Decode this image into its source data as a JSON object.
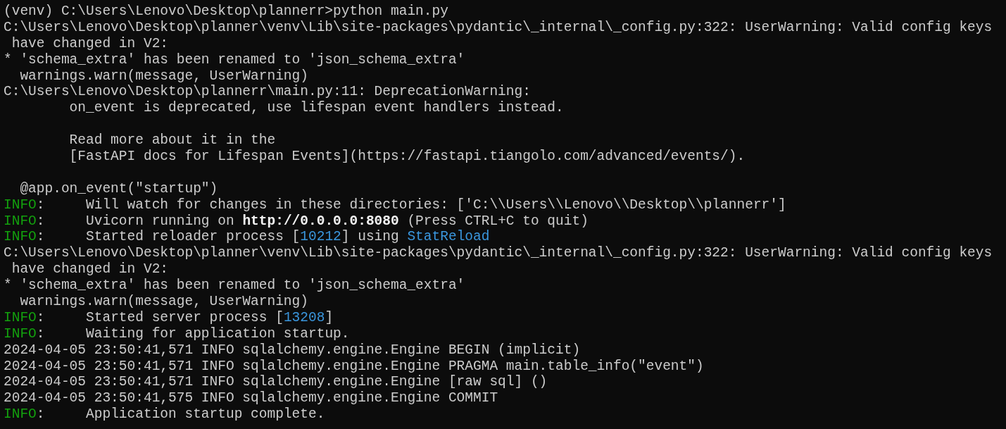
{
  "terminal": {
    "lines": [
      {
        "kind": "text",
        "segments": [
          {
            "kind": "plain",
            "text": "(venv) C:\\Users\\Lenovo\\Desktop\\plannerr>python main.py"
          }
        ]
      },
      {
        "kind": "text",
        "segments": [
          {
            "kind": "plain",
            "text": "C:\\Users\\Lenovo\\Desktop\\planner\\venv\\Lib\\site-packages\\pydantic\\_internal\\_config.py:322: UserWarning: Valid config keys"
          }
        ]
      },
      {
        "kind": "text",
        "segments": [
          {
            "kind": "plain",
            "text": " have changed in V2:"
          }
        ]
      },
      {
        "kind": "text",
        "segments": [
          {
            "kind": "plain",
            "text": "* 'schema_extra' has been renamed to 'json_schema_extra'"
          }
        ]
      },
      {
        "kind": "text",
        "segments": [
          {
            "kind": "plain",
            "text": "  warnings.warn(message, UserWarning)"
          }
        ]
      },
      {
        "kind": "text",
        "segments": [
          {
            "kind": "plain",
            "text": "C:\\Users\\Lenovo\\Desktop\\plannerr\\main.py:11: DeprecationWarning:"
          }
        ]
      },
      {
        "kind": "text",
        "segments": [
          {
            "kind": "plain",
            "text": "        on_event is deprecated, use lifespan event handlers instead."
          }
        ]
      },
      {
        "kind": "blank"
      },
      {
        "kind": "text",
        "segments": [
          {
            "kind": "plain",
            "text": "        Read more about it in the"
          }
        ]
      },
      {
        "kind": "text",
        "segments": [
          {
            "kind": "plain",
            "text": "        [FastAPI docs for Lifespan Events](https://fastapi.tiangolo.com/advanced/events/)."
          }
        ]
      },
      {
        "kind": "blank"
      },
      {
        "kind": "text",
        "segments": [
          {
            "kind": "plain",
            "text": "  @app.on_event(\"startup\")"
          }
        ]
      },
      {
        "kind": "text",
        "segments": [
          {
            "kind": "info",
            "text": "INFO"
          },
          {
            "kind": "plain",
            "text": ":     Will watch for changes in these directories: ['C:\\\\Users\\\\Lenovo\\\\Desktop\\\\plannerr']"
          }
        ]
      },
      {
        "kind": "text",
        "segments": [
          {
            "kind": "info",
            "text": "INFO"
          },
          {
            "kind": "plain",
            "text": ":     Uvicorn running on "
          },
          {
            "kind": "bold",
            "text": "http://0.0.0.0:8080"
          },
          {
            "kind": "plain",
            "text": " (Press CTRL+C to quit)"
          }
        ]
      },
      {
        "kind": "text",
        "segments": [
          {
            "kind": "info",
            "text": "INFO"
          },
          {
            "kind": "plain",
            "text": ":     Started reloader process ["
          },
          {
            "kind": "highlight",
            "text": "10212"
          },
          {
            "kind": "plain",
            "text": "] using "
          },
          {
            "kind": "highlight",
            "text": "StatReload"
          }
        ]
      },
      {
        "kind": "text",
        "segments": [
          {
            "kind": "plain",
            "text": "C:\\Users\\Lenovo\\Desktop\\planner\\venv\\Lib\\site-packages\\pydantic\\_internal\\_config.py:322: UserWarning: Valid config keys"
          }
        ]
      },
      {
        "kind": "text",
        "segments": [
          {
            "kind": "plain",
            "text": " have changed in V2:"
          }
        ]
      },
      {
        "kind": "text",
        "segments": [
          {
            "kind": "plain",
            "text": "* 'schema_extra' has been renamed to 'json_schema_extra'"
          }
        ]
      },
      {
        "kind": "text",
        "segments": [
          {
            "kind": "plain",
            "text": "  warnings.warn(message, UserWarning)"
          }
        ]
      },
      {
        "kind": "text",
        "segments": [
          {
            "kind": "info",
            "text": "INFO"
          },
          {
            "kind": "plain",
            "text": ":     Started server process ["
          },
          {
            "kind": "highlight",
            "text": "13208"
          },
          {
            "kind": "plain",
            "text": "]"
          }
        ]
      },
      {
        "kind": "text",
        "segments": [
          {
            "kind": "info",
            "text": "INFO"
          },
          {
            "kind": "plain",
            "text": ":     Waiting for application startup."
          }
        ]
      },
      {
        "kind": "text",
        "segments": [
          {
            "kind": "plain",
            "text": "2024-04-05 23:50:41,571 INFO sqlalchemy.engine.Engine BEGIN (implicit)"
          }
        ]
      },
      {
        "kind": "text",
        "segments": [
          {
            "kind": "plain",
            "text": "2024-04-05 23:50:41,571 INFO sqlalchemy.engine.Engine PRAGMA main.table_info(\"event\")"
          }
        ]
      },
      {
        "kind": "text",
        "segments": [
          {
            "kind": "plain",
            "text": "2024-04-05 23:50:41,571 INFO sqlalchemy.engine.Engine [raw sql] ()"
          }
        ]
      },
      {
        "kind": "text",
        "segments": [
          {
            "kind": "plain",
            "text": "2024-04-05 23:50:41,575 INFO sqlalchemy.engine.Engine COMMIT"
          }
        ]
      },
      {
        "kind": "text",
        "segments": [
          {
            "kind": "info",
            "text": "INFO"
          },
          {
            "kind": "plain",
            "text": ":     Application startup complete."
          }
        ]
      }
    ]
  }
}
